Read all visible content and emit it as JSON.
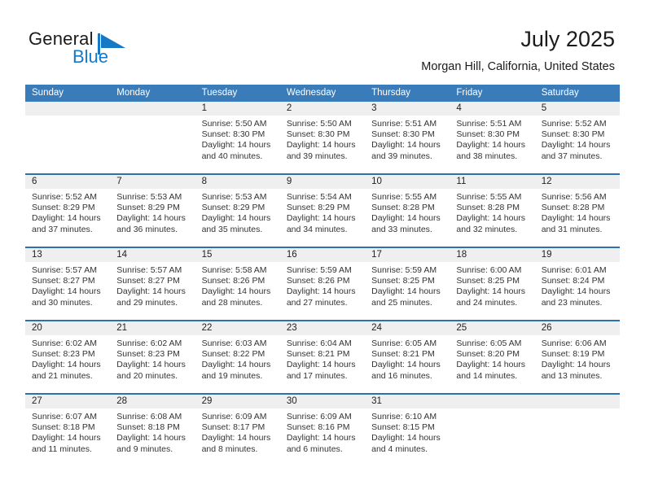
{
  "brand": {
    "name_part1": "General",
    "name_part2": "Blue",
    "flag_icon": "blue-triangle-flag-icon",
    "accent_color": "#1679c6"
  },
  "header": {
    "title": "July 2025",
    "subtitle": "Morgan Hill, California, United States"
  },
  "colors": {
    "header_bar": "#3a7cba",
    "week_rule": "#2f6fad",
    "daynum_band": "#efefef",
    "text": "#333333"
  },
  "weekdays": [
    "Sunday",
    "Monday",
    "Tuesday",
    "Wednesday",
    "Thursday",
    "Friday",
    "Saturday"
  ],
  "weeks": [
    {
      "days": [
        {
          "num": "",
          "lines": []
        },
        {
          "num": "",
          "lines": []
        },
        {
          "num": "1",
          "lines": [
            "Sunrise: 5:50 AM",
            "Sunset: 8:30 PM",
            "Daylight: 14 hours",
            "and 40 minutes."
          ]
        },
        {
          "num": "2",
          "lines": [
            "Sunrise: 5:50 AM",
            "Sunset: 8:30 PM",
            "Daylight: 14 hours",
            "and 39 minutes."
          ]
        },
        {
          "num": "3",
          "lines": [
            "Sunrise: 5:51 AM",
            "Sunset: 8:30 PM",
            "Daylight: 14 hours",
            "and 39 minutes."
          ]
        },
        {
          "num": "4",
          "lines": [
            "Sunrise: 5:51 AM",
            "Sunset: 8:30 PM",
            "Daylight: 14 hours",
            "and 38 minutes."
          ]
        },
        {
          "num": "5",
          "lines": [
            "Sunrise: 5:52 AM",
            "Sunset: 8:30 PM",
            "Daylight: 14 hours",
            "and 37 minutes."
          ]
        }
      ]
    },
    {
      "days": [
        {
          "num": "6",
          "lines": [
            "Sunrise: 5:52 AM",
            "Sunset: 8:29 PM",
            "Daylight: 14 hours",
            "and 37 minutes."
          ]
        },
        {
          "num": "7",
          "lines": [
            "Sunrise: 5:53 AM",
            "Sunset: 8:29 PM",
            "Daylight: 14 hours",
            "and 36 minutes."
          ]
        },
        {
          "num": "8",
          "lines": [
            "Sunrise: 5:53 AM",
            "Sunset: 8:29 PM",
            "Daylight: 14 hours",
            "and 35 minutes."
          ]
        },
        {
          "num": "9",
          "lines": [
            "Sunrise: 5:54 AM",
            "Sunset: 8:29 PM",
            "Daylight: 14 hours",
            "and 34 minutes."
          ]
        },
        {
          "num": "10",
          "lines": [
            "Sunrise: 5:55 AM",
            "Sunset: 8:28 PM",
            "Daylight: 14 hours",
            "and 33 minutes."
          ]
        },
        {
          "num": "11",
          "lines": [
            "Sunrise: 5:55 AM",
            "Sunset: 8:28 PM",
            "Daylight: 14 hours",
            "and 32 minutes."
          ]
        },
        {
          "num": "12",
          "lines": [
            "Sunrise: 5:56 AM",
            "Sunset: 8:28 PM",
            "Daylight: 14 hours",
            "and 31 minutes."
          ]
        }
      ]
    },
    {
      "days": [
        {
          "num": "13",
          "lines": [
            "Sunrise: 5:57 AM",
            "Sunset: 8:27 PM",
            "Daylight: 14 hours",
            "and 30 minutes."
          ]
        },
        {
          "num": "14",
          "lines": [
            "Sunrise: 5:57 AM",
            "Sunset: 8:27 PM",
            "Daylight: 14 hours",
            "and 29 minutes."
          ]
        },
        {
          "num": "15",
          "lines": [
            "Sunrise: 5:58 AM",
            "Sunset: 8:26 PM",
            "Daylight: 14 hours",
            "and 28 minutes."
          ]
        },
        {
          "num": "16",
          "lines": [
            "Sunrise: 5:59 AM",
            "Sunset: 8:26 PM",
            "Daylight: 14 hours",
            "and 27 minutes."
          ]
        },
        {
          "num": "17",
          "lines": [
            "Sunrise: 5:59 AM",
            "Sunset: 8:25 PM",
            "Daylight: 14 hours",
            "and 25 minutes."
          ]
        },
        {
          "num": "18",
          "lines": [
            "Sunrise: 6:00 AM",
            "Sunset: 8:25 PM",
            "Daylight: 14 hours",
            "and 24 minutes."
          ]
        },
        {
          "num": "19",
          "lines": [
            "Sunrise: 6:01 AM",
            "Sunset: 8:24 PM",
            "Daylight: 14 hours",
            "and 23 minutes."
          ]
        }
      ]
    },
    {
      "days": [
        {
          "num": "20",
          "lines": [
            "Sunrise: 6:02 AM",
            "Sunset: 8:23 PM",
            "Daylight: 14 hours",
            "and 21 minutes."
          ]
        },
        {
          "num": "21",
          "lines": [
            "Sunrise: 6:02 AM",
            "Sunset: 8:23 PM",
            "Daylight: 14 hours",
            "and 20 minutes."
          ]
        },
        {
          "num": "22",
          "lines": [
            "Sunrise: 6:03 AM",
            "Sunset: 8:22 PM",
            "Daylight: 14 hours",
            "and 19 minutes."
          ]
        },
        {
          "num": "23",
          "lines": [
            "Sunrise: 6:04 AM",
            "Sunset: 8:21 PM",
            "Daylight: 14 hours",
            "and 17 minutes."
          ]
        },
        {
          "num": "24",
          "lines": [
            "Sunrise: 6:05 AM",
            "Sunset: 8:21 PM",
            "Daylight: 14 hours",
            "and 16 minutes."
          ]
        },
        {
          "num": "25",
          "lines": [
            "Sunrise: 6:05 AM",
            "Sunset: 8:20 PM",
            "Daylight: 14 hours",
            "and 14 minutes."
          ]
        },
        {
          "num": "26",
          "lines": [
            "Sunrise: 6:06 AM",
            "Sunset: 8:19 PM",
            "Daylight: 14 hours",
            "and 13 minutes."
          ]
        }
      ]
    },
    {
      "days": [
        {
          "num": "27",
          "lines": [
            "Sunrise: 6:07 AM",
            "Sunset: 8:18 PM",
            "Daylight: 14 hours",
            "and 11 minutes."
          ]
        },
        {
          "num": "28",
          "lines": [
            "Sunrise: 6:08 AM",
            "Sunset: 8:18 PM",
            "Daylight: 14 hours",
            "and 9 minutes."
          ]
        },
        {
          "num": "29",
          "lines": [
            "Sunrise: 6:09 AM",
            "Sunset: 8:17 PM",
            "Daylight: 14 hours",
            "and 8 minutes."
          ]
        },
        {
          "num": "30",
          "lines": [
            "Sunrise: 6:09 AM",
            "Sunset: 8:16 PM",
            "Daylight: 14 hours",
            "and 6 minutes."
          ]
        },
        {
          "num": "31",
          "lines": [
            "Sunrise: 6:10 AM",
            "Sunset: 8:15 PM",
            "Daylight: 14 hours",
            "and 4 minutes."
          ]
        },
        {
          "num": "",
          "lines": []
        },
        {
          "num": "",
          "lines": []
        }
      ]
    }
  ]
}
